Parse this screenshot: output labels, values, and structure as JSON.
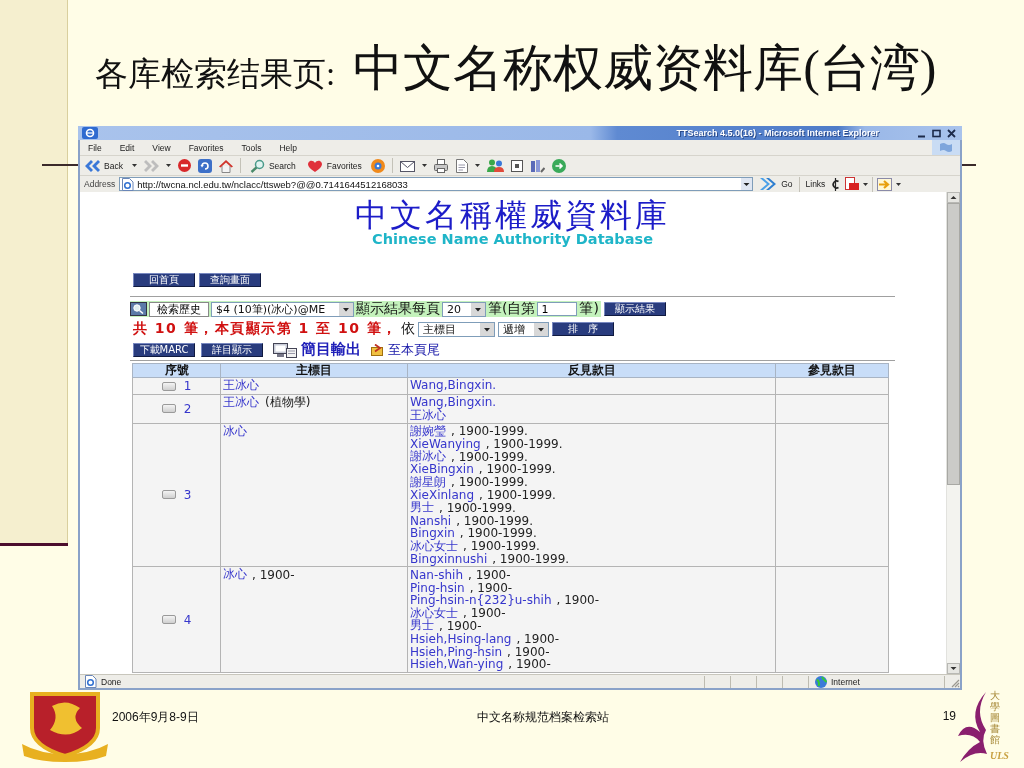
{
  "slide": {
    "title_prefix": "各库检索结果页:",
    "title_main": "中文名称权威资料库(台湾)",
    "footer": {
      "date": "2006年9月8-9日",
      "center": "中文名称规范档案检索站",
      "page_number": "19",
      "logo_text": "大學圖書館",
      "logo_mark": "ULS"
    }
  },
  "browser": {
    "title": "TTSearch 4.5.0(16) - Microsoft Internet Explorer",
    "menu": [
      "File",
      "Edit",
      "View",
      "Favorites",
      "Tools",
      "Help"
    ],
    "toolbar": {
      "back": "Back",
      "search": "Search",
      "favorites": "Favorites"
    },
    "address": {
      "label": "Address",
      "url": "http://twcna.ncl.edu.tw/nclacc/ttsweb?@@0.7141644512168033",
      "go": "Go",
      "links": "Links"
    },
    "status": {
      "text": "Done",
      "zone": "Internet"
    }
  },
  "page": {
    "title": "中文名稱權威資料庫",
    "subtitle": "Chinese Name Authority Database",
    "nav_buttons": [
      "回首頁",
      "查詢畫面"
    ],
    "history": {
      "button": "檢索歷史",
      "value": "$4 (10筆)(冰心)@ME"
    },
    "per_page": {
      "label": "顯示結果每頁",
      "value": "20",
      "from_label": "筆(自第",
      "from_value": "1",
      "end_label": "筆)",
      "button": "顯示結果"
    },
    "summary": "共 10 筆，本頁顯示第 1 至 10 筆，",
    "sort": {
      "label": "依",
      "field": "主標目",
      "order": "遞增",
      "button": "排　序"
    },
    "actions": [
      {
        "kind": "button",
        "label": "下載MARC"
      },
      {
        "kind": "button",
        "label": "詳目顯示"
      },
      {
        "kind": "export",
        "label": "簡目輸出"
      },
      {
        "kind": "jump",
        "label": "至本頁尾"
      }
    ],
    "table": {
      "columns": [
        "序號",
        "主標目",
        "反見款目",
        "參見款目"
      ],
      "rows": [
        {
          "number": "1",
          "checked": false,
          "heading": {
            "name": "王冰心"
          },
          "see_from": [
            {
              "name": "Wang,Bingxin."
            }
          ]
        },
        {
          "number": "2",
          "checked": false,
          "heading": {
            "name": "王冰心",
            "qualifier": "(植物學)"
          },
          "see_from": [
            {
              "name": "Wang,Bingxin."
            },
            {
              "name": "王冰心"
            }
          ]
        },
        {
          "number": "3",
          "checked": false,
          "heading": {
            "name": "冰心"
          },
          "see_from": [
            {
              "name": "謝婉瑩",
              "dates": ", 1900-1999."
            },
            {
              "name": "XieWanying",
              "dates": ", 1900-1999."
            },
            {
              "name": "謝冰心",
              "dates": ", 1900-1999."
            },
            {
              "name": "XieBingxin",
              "dates": ", 1900-1999."
            },
            {
              "name": "謝星朗",
              "dates": ", 1900-1999."
            },
            {
              "name": "XieXinlang",
              "dates": ", 1900-1999."
            },
            {
              "name": "男士",
              "dates": ", 1900-1999."
            },
            {
              "name": "Nanshi",
              "dates": ", 1900-1999."
            },
            {
              "name": "Bingxin",
              "dates": ", 1900-1999."
            },
            {
              "name": "冰心女士",
              "dates": ", 1900-1999."
            },
            {
              "name": "Bingxinnushi",
              "dates": ", 1900-1999."
            }
          ]
        },
        {
          "number": "4",
          "checked": false,
          "heading": {
            "name": "冰心",
            "dates": ", 1900-"
          },
          "see_from": [
            {
              "name": "Nan-shih",
              "dates": ", 1900-"
            },
            {
              "name": "Ping-hsin",
              "dates": ", 1900-"
            },
            {
              "name": "Ping-hsin-n{232}u-shih",
              "dates": ", 1900-"
            },
            {
              "name": "冰心女士",
              "dates": ", 1900-"
            },
            {
              "name": "男士",
              "dates": ", 1900-"
            },
            {
              "name": "Hsieh,Hsing-lang",
              "dates": ", 1900-"
            },
            {
              "name": "Hsieh,Ping-hsin",
              "dates": ", 1900-"
            },
            {
              "name": "Hsieh,Wan-ying",
              "dates": ", 1900-"
            }
          ]
        }
      ]
    }
  }
}
